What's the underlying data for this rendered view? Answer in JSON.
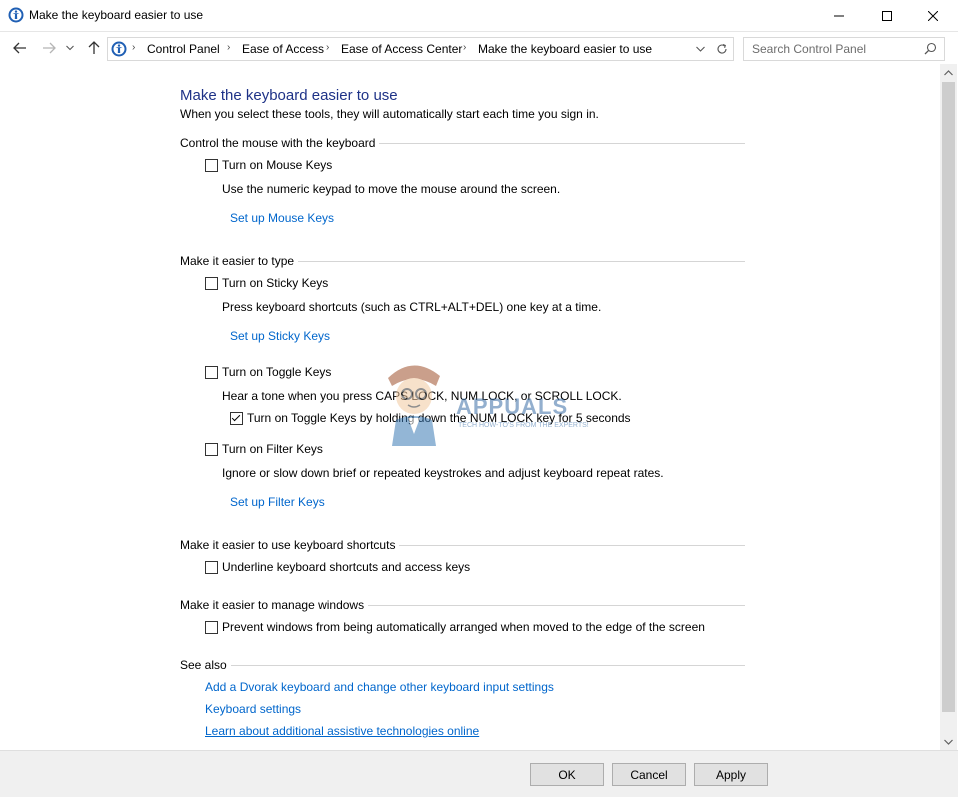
{
  "window": {
    "title": "Make the keyboard easier to use"
  },
  "nav": {
    "breadcrumbs": [
      "Control Panel",
      "Ease of Access",
      "Ease of Access Center",
      "Make the keyboard easier to use"
    ],
    "search_placeholder": "Search Control Panel"
  },
  "main": {
    "heading": "Make the keyboard easier to use",
    "subtitle": "When you select these tools, they will automatically start each time you sign in.",
    "sections": {
      "mouse": {
        "title": "Control the mouse with the keyboard",
        "mouse_keys_label": "Turn on Mouse Keys",
        "mouse_keys_checked": false,
        "mouse_keys_desc": "Use the numeric keypad to move the mouse around the screen.",
        "mouse_keys_link": "Set up Mouse Keys"
      },
      "typing": {
        "title": "Make it easier to type",
        "sticky_label": "Turn on Sticky Keys",
        "sticky_checked": false,
        "sticky_desc": "Press keyboard shortcuts (such as CTRL+ALT+DEL) one key at a time.",
        "sticky_link": "Set up Sticky Keys",
        "toggle_label": "Turn on Toggle Keys",
        "toggle_checked": false,
        "toggle_desc": "Hear a tone when you press CAPS LOCK, NUM LOCK, or SCROLL LOCK.",
        "toggle_hold_label": "Turn on Toggle Keys by holding down the NUM LOCK key for 5 seconds",
        "toggle_hold_checked": true,
        "filter_label": "Turn on Filter Keys",
        "filter_checked": false,
        "filter_desc": "Ignore or slow down brief or repeated keystrokes and adjust keyboard repeat rates.",
        "filter_link": "Set up Filter Keys"
      },
      "shortcuts": {
        "title": "Make it easier to use keyboard shortcuts",
        "underline_label": "Underline keyboard shortcuts and access keys",
        "underline_checked": false
      },
      "windows": {
        "title": "Make it easier to manage windows",
        "prevent_label": "Prevent windows from being automatically arranged when moved to the edge of the screen",
        "prevent_checked": false
      },
      "see_also": {
        "title": "See also",
        "links": [
          "Add a Dvorak keyboard and change other keyboard input settings",
          "Keyboard settings",
          "Learn about additional assistive technologies online"
        ]
      }
    }
  },
  "buttons": {
    "ok": "OK",
    "cancel": "Cancel",
    "apply": "Apply"
  },
  "watermark": {
    "brand": "APPUALS",
    "tagline": "TECH HOW-TO'S FROM THE EXPERTS!"
  },
  "colors": {
    "heading": "#1e3287",
    "link": "#0066cc"
  }
}
